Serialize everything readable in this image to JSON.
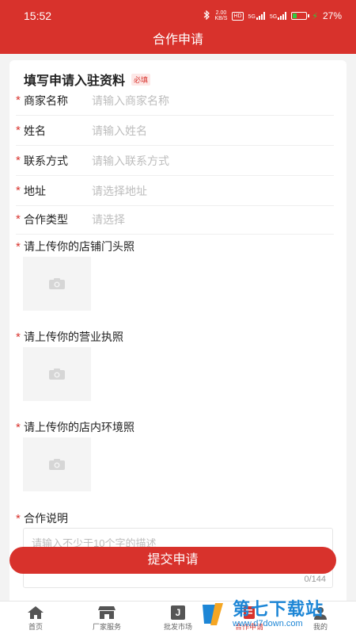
{
  "status_bar": {
    "time": "15:52",
    "net_speed": "2.00",
    "net_unit": "KB/S",
    "hd": "HD",
    "sig1": "5G",
    "sig2": "5G",
    "battery": "27%"
  },
  "header": {
    "title": "合作申请"
  },
  "form": {
    "title": "填写申请入驻资料",
    "required_tag": "必填",
    "required_mark": "*",
    "fields": [
      {
        "label": "商家名称",
        "placeholder": "请输入商家名称"
      },
      {
        "label": "姓名",
        "placeholder": "请输入姓名"
      },
      {
        "label": "联系方式",
        "placeholder": "请输入联系方式"
      },
      {
        "label": "地址",
        "placeholder": "请选择地址"
      },
      {
        "label": "合作类型",
        "placeholder": "请选择"
      }
    ],
    "uploads": [
      {
        "label": "请上传你的店铺门头照"
      },
      {
        "label": "请上传你的营业执照"
      },
      {
        "label": "请上传你的店内环境照"
      }
    ],
    "description": {
      "label": "合作说明",
      "placeholder": "请输入不少于10个字的描述",
      "counter": "0/144"
    },
    "submit_label": "提交申请"
  },
  "bottom_nav": [
    {
      "label": "首页",
      "icon": "home-icon"
    },
    {
      "label": "厂家服务",
      "icon": "store-icon"
    },
    {
      "label": "批发市场",
      "icon": "wholesale-icon",
      "icon_text": "J"
    },
    {
      "label": "合作申请",
      "icon": "apply-icon",
      "active": true
    },
    {
      "label": "我的",
      "icon": "user-icon"
    }
  ],
  "watermark": {
    "name": "第七下载站",
    "url": "www.d7down.com"
  },
  "colors": {
    "primary": "#d8322c",
    "placeholder": "#bdbdbd",
    "watermark": "#1d86d6"
  }
}
